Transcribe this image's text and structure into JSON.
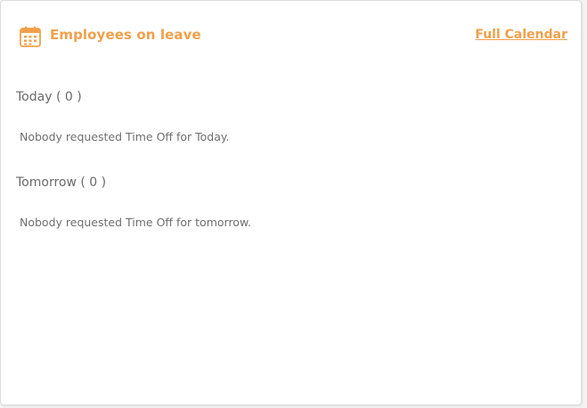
{
  "widget": {
    "title": "Employees on leave",
    "full_calendar_link": "Full Calendar",
    "icon": "calendar-icon",
    "accent_color": "#f0a04b"
  },
  "sections": [
    {
      "title": "Today ( 0 )",
      "message": "Nobody requested Time Off for Today."
    },
    {
      "title": "Tomorrow ( 0 )",
      "message": "Nobody requested Time Off for tomorrow."
    }
  ]
}
